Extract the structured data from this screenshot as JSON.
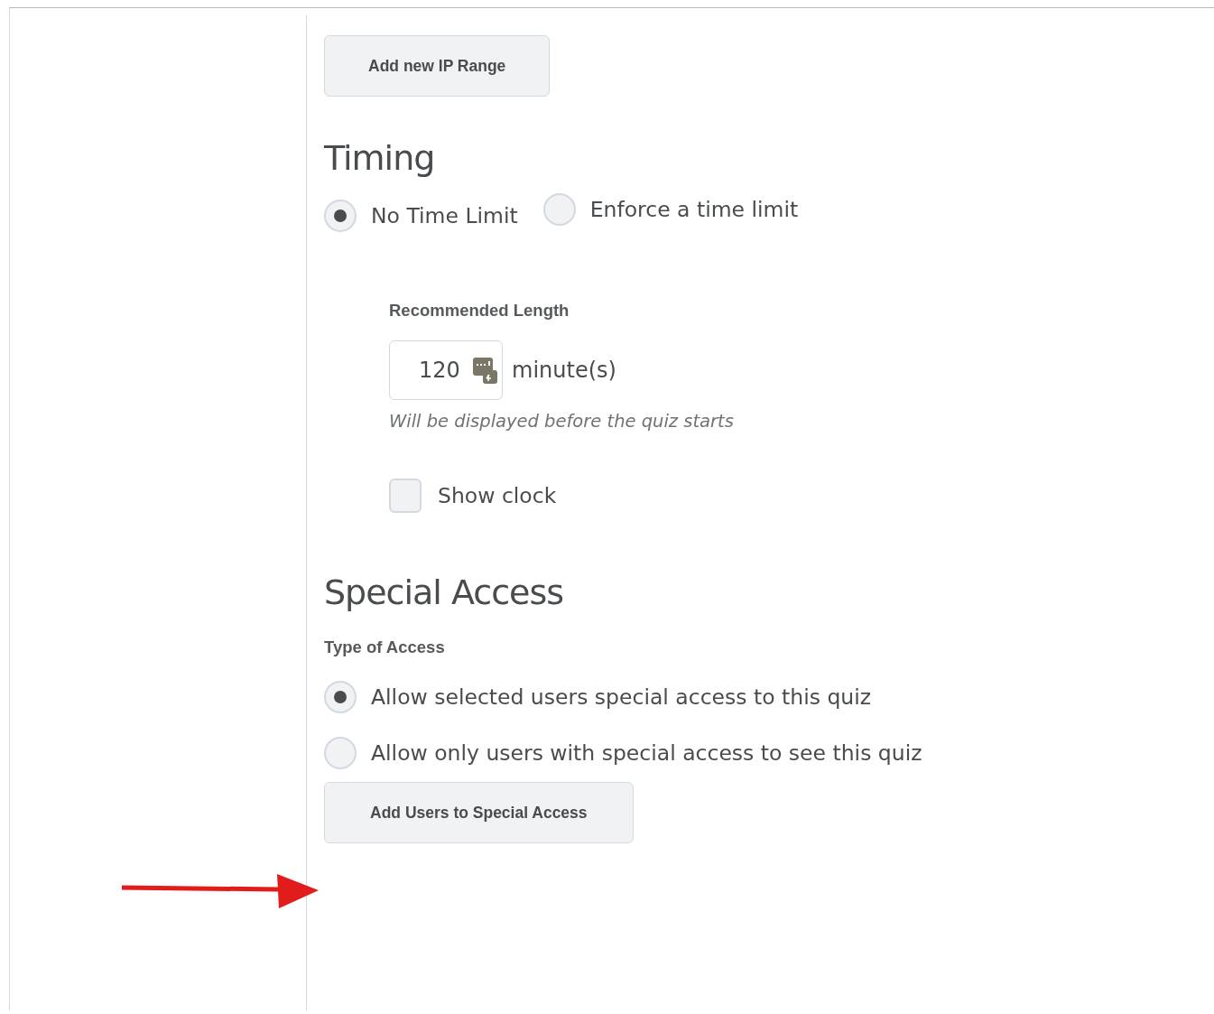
{
  "ip_button": "Add new IP Range",
  "timing": {
    "heading": "Timing",
    "options": [
      {
        "label": "No Time Limit",
        "selected": true
      },
      {
        "label": "Enforce a time limit",
        "selected": false
      }
    ],
    "length_label": "Recommended Length",
    "length_value": "120",
    "unit": "minute(s)",
    "hint": "Will be displayed before the quiz starts",
    "show_clock": {
      "label": "Show clock",
      "checked": false
    }
  },
  "special": {
    "heading": "Special Access",
    "type_label": "Type of Access",
    "options": [
      {
        "label": "Allow selected users special access to this quiz",
        "selected": true
      },
      {
        "label": "Allow only users with special access to see this quiz",
        "selected": false
      }
    ],
    "button": "Add Users to Special Access"
  }
}
